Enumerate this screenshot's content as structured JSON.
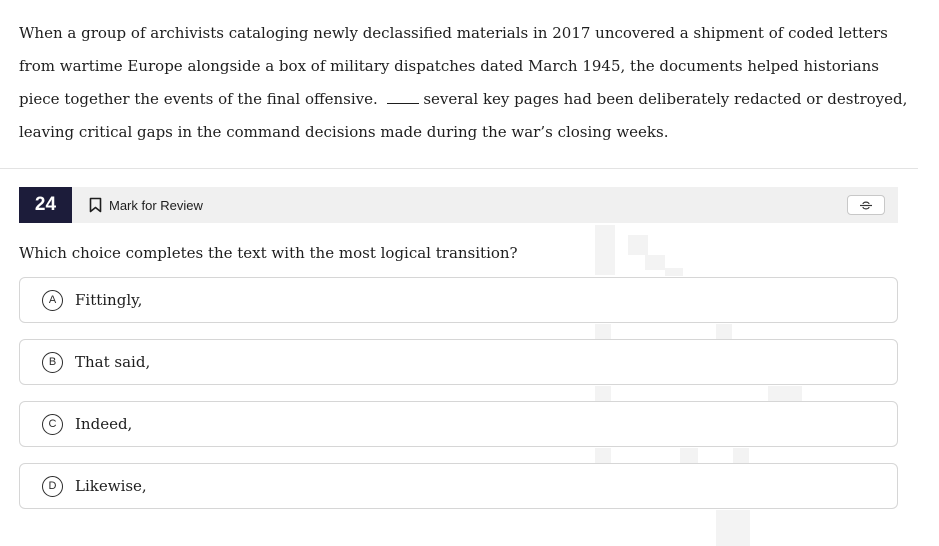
{
  "passage": {
    "part1": "When a group of archivists cataloging newly declassified materials in 2017 uncovered a shipment of coded letters from wartime Europe alongside a box of military dispatches dated March 1945, the documents helped historians piece together the events of the final offensive.",
    "part2": "several key pages had been deliberately redacted or destroyed, leaving critical gaps in the command decisions made during the war’s closing weeks."
  },
  "question_header": {
    "number": "24",
    "mark_for_review_label": "Mark for Review",
    "bookmark_icon": "bookmark-icon",
    "strikethrough_icon": "abc-strikethrough-icon"
  },
  "question": {
    "prompt": "Which choice completes the text with the most logical transition?"
  },
  "choices": [
    {
      "letter": "A",
      "text": "Fittingly,"
    },
    {
      "letter": "B",
      "text": "That said,"
    },
    {
      "letter": "C",
      "text": "Indeed,"
    },
    {
      "letter": "D",
      "text": "Likewise,"
    }
  ],
  "colors": {
    "question_number_bg": "#1c1c3a",
    "header_bar_bg": "#f0f0f0",
    "choice_border": "#d6d6d6"
  }
}
